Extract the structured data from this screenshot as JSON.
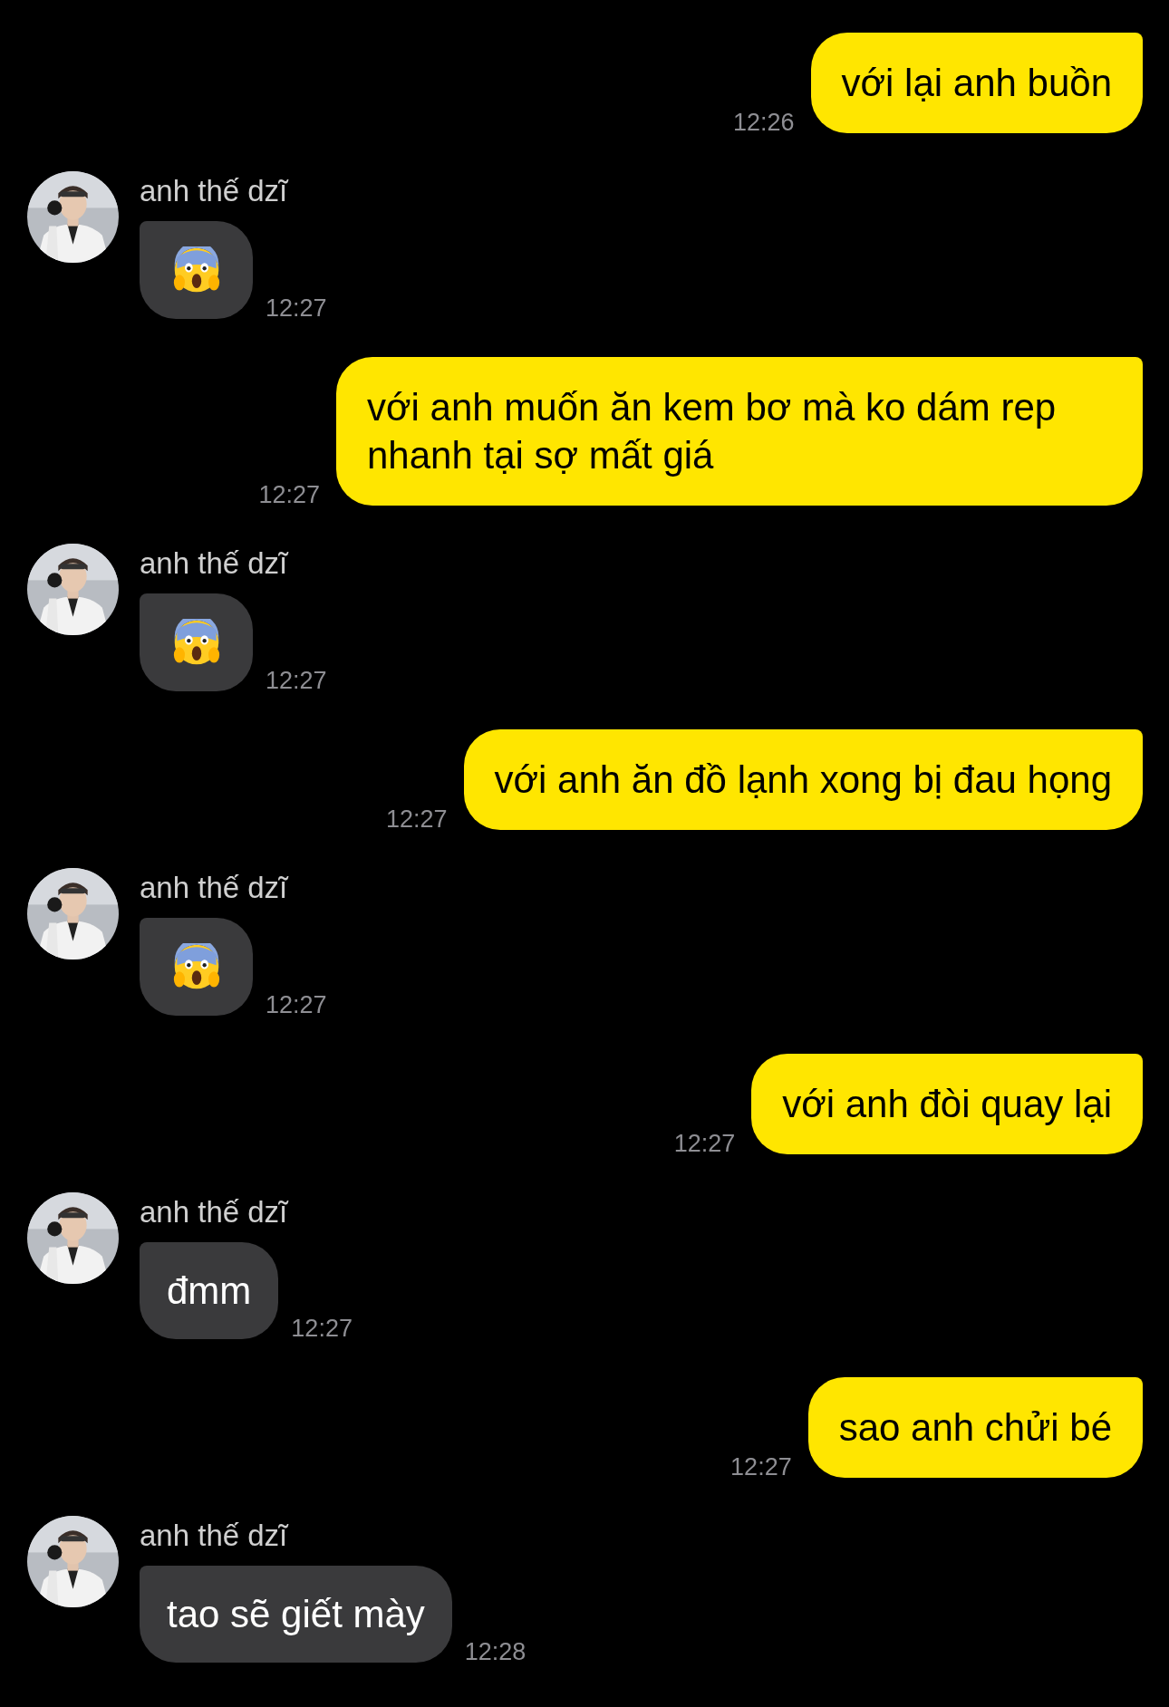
{
  "messages": [
    {
      "kind": "sent",
      "text": "với lại anh buồn",
      "time": "12:26"
    },
    {
      "kind": "received_emoji",
      "sender": "anh thế dzĩ",
      "time": "12:27"
    },
    {
      "kind": "sent",
      "text": "với anh muốn ăn kem bơ mà ko dám rep nhanh tại sợ mất giá",
      "time": "12:27"
    },
    {
      "kind": "received_emoji",
      "sender": "anh thế dzĩ",
      "time": "12:27"
    },
    {
      "kind": "sent",
      "text": "với anh ăn đồ lạnh xong bị đau họng",
      "time": "12:27"
    },
    {
      "kind": "received_emoji",
      "sender": "anh thế dzĩ",
      "time": "12:27"
    },
    {
      "kind": "sent",
      "text": "với anh đòi quay lại",
      "time": "12:27"
    },
    {
      "kind": "received",
      "sender": "anh thế dzĩ",
      "text": "đmm",
      "time": "12:27"
    },
    {
      "kind": "sent",
      "text": "sao anh chửi bé",
      "time": "12:27"
    },
    {
      "kind": "received",
      "sender": "anh thế dzĩ",
      "text": "tao sẽ giết mày",
      "time": "12:28"
    }
  ]
}
